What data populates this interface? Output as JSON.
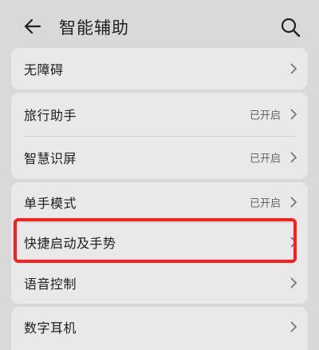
{
  "header": {
    "title": "智能辅助",
    "back_icon": "arrow-left-icon",
    "search_icon": "search-icon"
  },
  "groups": [
    {
      "items": [
        {
          "label": "无障碍",
          "status": ""
        }
      ]
    },
    {
      "items": [
        {
          "label": "旅行助手",
          "status": "已开启"
        },
        {
          "label": "智慧识屏",
          "status": "已开启"
        }
      ]
    },
    {
      "items": [
        {
          "label": "单手模式",
          "status": "已开启"
        },
        {
          "label": "快捷启动及手势",
          "status": ""
        },
        {
          "label": "语音控制",
          "status": ""
        }
      ]
    },
    {
      "items": [
        {
          "label": "数字耳机",
          "status": ""
        }
      ]
    }
  ],
  "colors": {
    "highlight": "#ff1e1e",
    "background": "#d9d9d9"
  }
}
